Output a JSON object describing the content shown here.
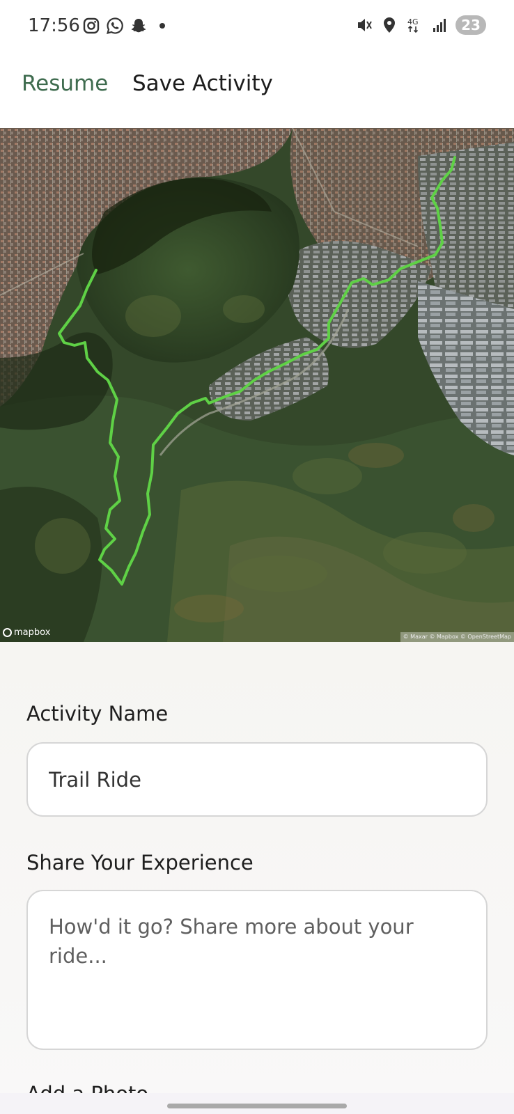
{
  "status_bar": {
    "time": "17:56",
    "left_icons": [
      "instagram-icon",
      "whatsapp-icon",
      "snapchat-icon",
      "dot-icon"
    ],
    "right_icons": [
      "mute-icon",
      "location-icon",
      "4g-icon",
      "signal-icon"
    ],
    "network": "4G",
    "battery": "23"
  },
  "header": {
    "resume_label": "Resume",
    "title": "Save Activity",
    "accent_color": "#3e6b4e"
  },
  "map": {
    "logo_text": "mapbox",
    "attribution": "© Maxar © Mapbox © OpenStreetMap",
    "route_color": "#5fd146"
  },
  "form": {
    "activity_name_label": "Activity Name",
    "activity_name_value": "Trail Ride",
    "experience_label": "Share Your Experience",
    "experience_placeholder": "How'd it go? Share more about your ride...",
    "photo_label": "Add a Photo"
  }
}
